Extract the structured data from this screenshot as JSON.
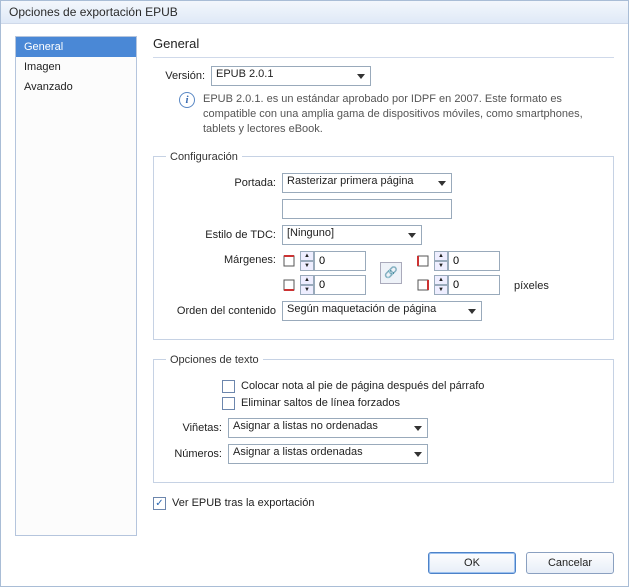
{
  "window": {
    "title": "Opciones de exportación EPUB"
  },
  "sidebar": {
    "items": [
      {
        "label": "General",
        "selected": true
      },
      {
        "label": "Imagen",
        "selected": false
      },
      {
        "label": "Avanzado",
        "selected": false
      }
    ]
  },
  "main": {
    "heading": "General",
    "version": {
      "label": "Versión:",
      "value": "EPUB 2.0.1",
      "info": "EPUB 2.0.1. es un estándar aprobado por IDPF en 2007. Este formato es compatible con una amplia gama de dispositivos móviles, como smartphones, tablets y lectores eBook."
    },
    "config": {
      "legend": "Configuración",
      "cover": {
        "label": "Portada:",
        "value": "Rasterizar primera página",
        "path": ""
      },
      "toc": {
        "label": "Estilo de TDC:",
        "value": "[Ninguno]"
      },
      "margins": {
        "label": "Márgenes:",
        "top": "0",
        "bottom": "0",
        "left": "0",
        "right": "0",
        "unit": "píxeles"
      },
      "order": {
        "label": "Orden del contenido",
        "value": "Según maquetación de página"
      }
    },
    "text_opts": {
      "legend": "Opciones de texto",
      "footnote": {
        "label": "Colocar nota al pie de página después del párrafo",
        "checked": false
      },
      "linebreaks": {
        "label": "Eliminar saltos de línea forzados",
        "checked": false
      },
      "bullets": {
        "label": "Viñetas:",
        "value": "Asignar a listas no ordenadas"
      },
      "numbers": {
        "label": "Números:",
        "value": "Asignar a listas ordenadas"
      }
    },
    "view_after": {
      "label": "Ver EPUB tras la exportación",
      "checked": true
    }
  },
  "footer": {
    "ok": "OK",
    "cancel": "Cancelar"
  }
}
